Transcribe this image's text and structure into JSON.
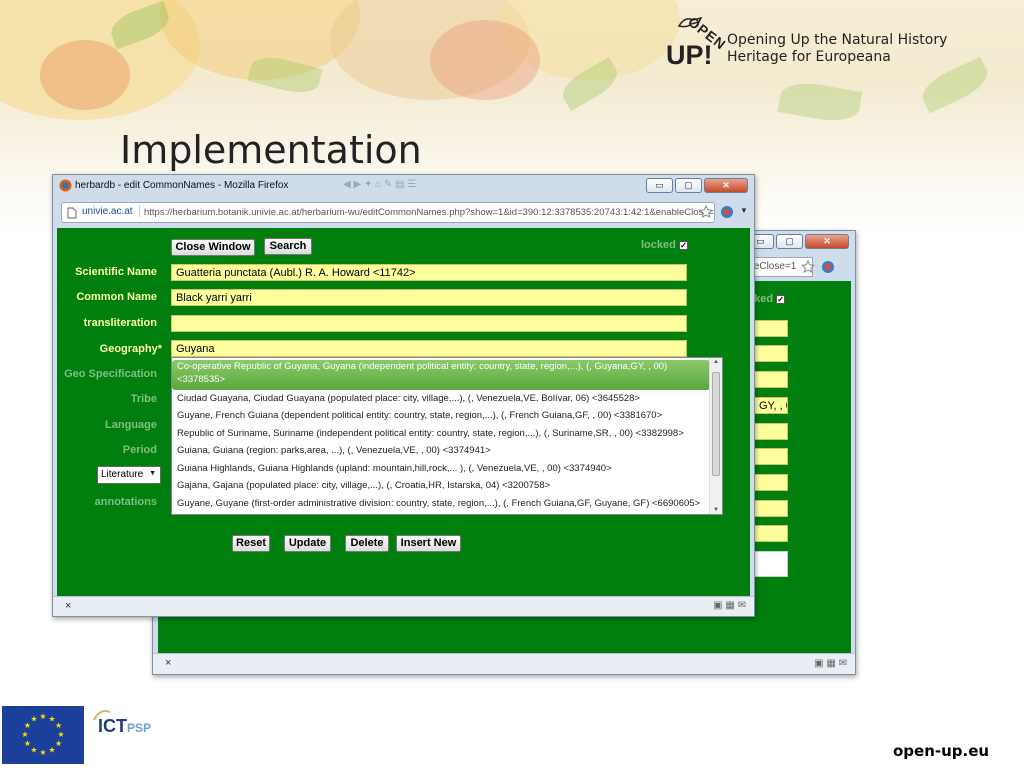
{
  "slide": {
    "title": "Implementation",
    "logo_open": "OPEN",
    "logo_up": "UP!",
    "logo_tagline": "Opening Up the Natural History Heritage for Europeana",
    "footer_url": "open-up.eu",
    "ict_logo": "ICT",
    "ict_logo_sub": "PSP"
  },
  "browser": {
    "window_title": "herbardb - edit CommonNames - Mozilla Firefox",
    "site_badge": "univie.ac.at",
    "url": "https://herbarium.botanik.univie.ac.at/herbarium-wu/editCommonNames.php?show=1&id=390:12:3378535:20743:1:42:1&enableClose=1",
    "close_tab": "×",
    "btn_min": "▭",
    "btn_max": "▢",
    "btn_close": "✕"
  },
  "back_window": {
    "url_fragment": "bleClose=1",
    "locked": "cked",
    "geo_fragment": "GY, , 0",
    "close_tab": "×"
  },
  "form": {
    "close_window": "Close Window",
    "search": "Search",
    "locked_label": "locked",
    "locked_check": "✓",
    "labels": {
      "scientific_name": "Scientific Name",
      "common_name": "Common Name",
      "transliteration": "transliteration",
      "geography": "Geography*",
      "geo_spec": "Geo Specification",
      "tribe": "Tribe",
      "language": "Language",
      "period": "Period",
      "annotations": "annotations"
    },
    "values": {
      "scientific_name": "Guatteria punctata  (Aubl.) R. A. Howard <11742>",
      "common_name": "Black yarri yarri",
      "transliteration": "",
      "geography": "Guyana"
    },
    "source_select": "Literature",
    "reset": "Reset",
    "update": "Update",
    "delete": "Delete",
    "insert_new": "Insert New"
  },
  "autocomplete": [
    "Co-operative Republic of Guyana, Guyana (independent political entity: country, state, region,...), (, Guyana,GY, , 00) <3378535>",
    "Ciudad Guayana, Ciudad Guayana (populated place: city, village,...), (, Venezuela,VE, Bolívar, 06) <3645528>",
    "Guyane, French Guiana (dependent political entity: country, state, region,...), (, French Guiana,GF, , 00) <3381670>",
    "Republic of Suriname, Suriname (independent political entity: country, state, region,...), (, Suriname,SR, , 00) <3382998>",
    "Guiana, Guiana (region: parks,area, ...), (, Venezuela,VE, , 00) <3374941>",
    "Guiana Highlands, Guiana Highlands (upland: mountain,hill,rock,... ), (, Venezuela,VE, , 00) <3374940>",
    "Gajana, Gajana (populated place: city, village,...), (, Croatia,HR, Istarska, 04) <3200758>",
    "Guyane, Guyane (first-order administrative division: country, state, region,...), (, French Guiana,GF, Guyane, GF) <6690605>"
  ],
  "colors": {
    "form_green": "#007f0f",
    "field_yellow": "#ffff9c",
    "label_yellow": "#ffffa0",
    "selection_green": "#6ab64a"
  }
}
